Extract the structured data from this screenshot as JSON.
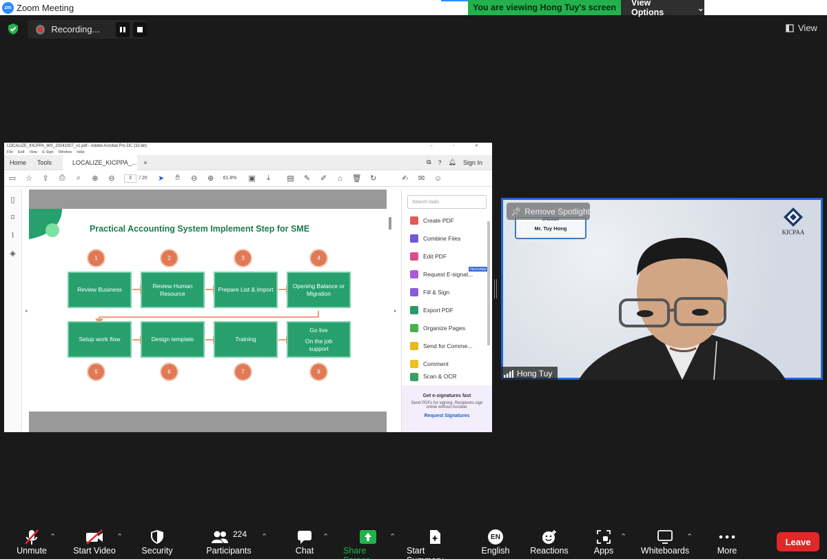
{
  "window": {
    "title": "Zoom Meeting",
    "logo": "zm"
  },
  "viewing": {
    "message": "You are viewing Hong Tuy's screen",
    "options_label": "View Options"
  },
  "recording": {
    "label": "Recording..."
  },
  "view_label": "View",
  "acrobat": {
    "title": "LOCALIZE_KICPPA_WS_20241007_v1.pdf - Adobe Acrobat Pro DC (32-bit)",
    "menu": [
      "File",
      "Edit",
      "View",
      "E-Sign",
      "Window",
      "Help"
    ],
    "tabs": {
      "home": "Home",
      "tools": "Tools",
      "doc": "LOCALIZE_KICPPA_...",
      "sign_in": "Sign In"
    },
    "page_current": "3",
    "page_total": "/ 20",
    "zoom": "61.8%",
    "search_placeholder": "Search tools",
    "tools": [
      "Create PDF",
      "Combine Files",
      "Edit PDF",
      "Request E-signat...",
      "Fill & Sign",
      "Export PDF",
      "Organize Pages",
      "Send for Comme...",
      "Comment",
      "Scan & OCR"
    ],
    "featured_badge": "FEATURED",
    "promo": {
      "heading": "Get e-signatures fast",
      "body": "Send PDFs for signing. Recipients sign online without Acrobat.",
      "link": "Request Signatures"
    }
  },
  "slide": {
    "title": "Practical Accounting System Implement Step for SME",
    "steps": [
      {
        "num": "1",
        "label": "Review Business"
      },
      {
        "num": "2",
        "label": "Review Human Resource"
      },
      {
        "num": "3",
        "label": "Prepare List & Import"
      },
      {
        "num": "4",
        "label": "Opening Balance or Migration"
      },
      {
        "num": "5",
        "label": "Setup work flow"
      },
      {
        "num": "6",
        "label": "Design template"
      },
      {
        "num": "7",
        "label": "Training"
      },
      {
        "num": "8",
        "label": "Go live",
        "label2": "On the job support"
      }
    ]
  },
  "speaker": {
    "remove_spotlight": "Remove Spotlight",
    "card_role": "SPEAKER",
    "card_name": "Mr. Tuy Hong",
    "logo_text": "KICPAA",
    "participant_name": "Hong Tuy"
  },
  "toolbar": {
    "unmute": "Unmute",
    "start_video": "Start Video",
    "security": "Security",
    "participants": "Participants",
    "participants_count": "224",
    "chat": "Chat",
    "share_screen": "Share Screen",
    "start_summary": "Start Summary",
    "language": "English",
    "language_code": "EN",
    "reactions": "Reactions",
    "apps": "Apps",
    "whiteboards": "Whiteboards",
    "more": "More",
    "leave": "Leave"
  },
  "colors": {
    "share_green": "#23b14d",
    "leave_red": "#e02828",
    "zoom_blue": "#2d8cff",
    "step_green": "#27a06e",
    "step_orange": "#e07a55"
  }
}
